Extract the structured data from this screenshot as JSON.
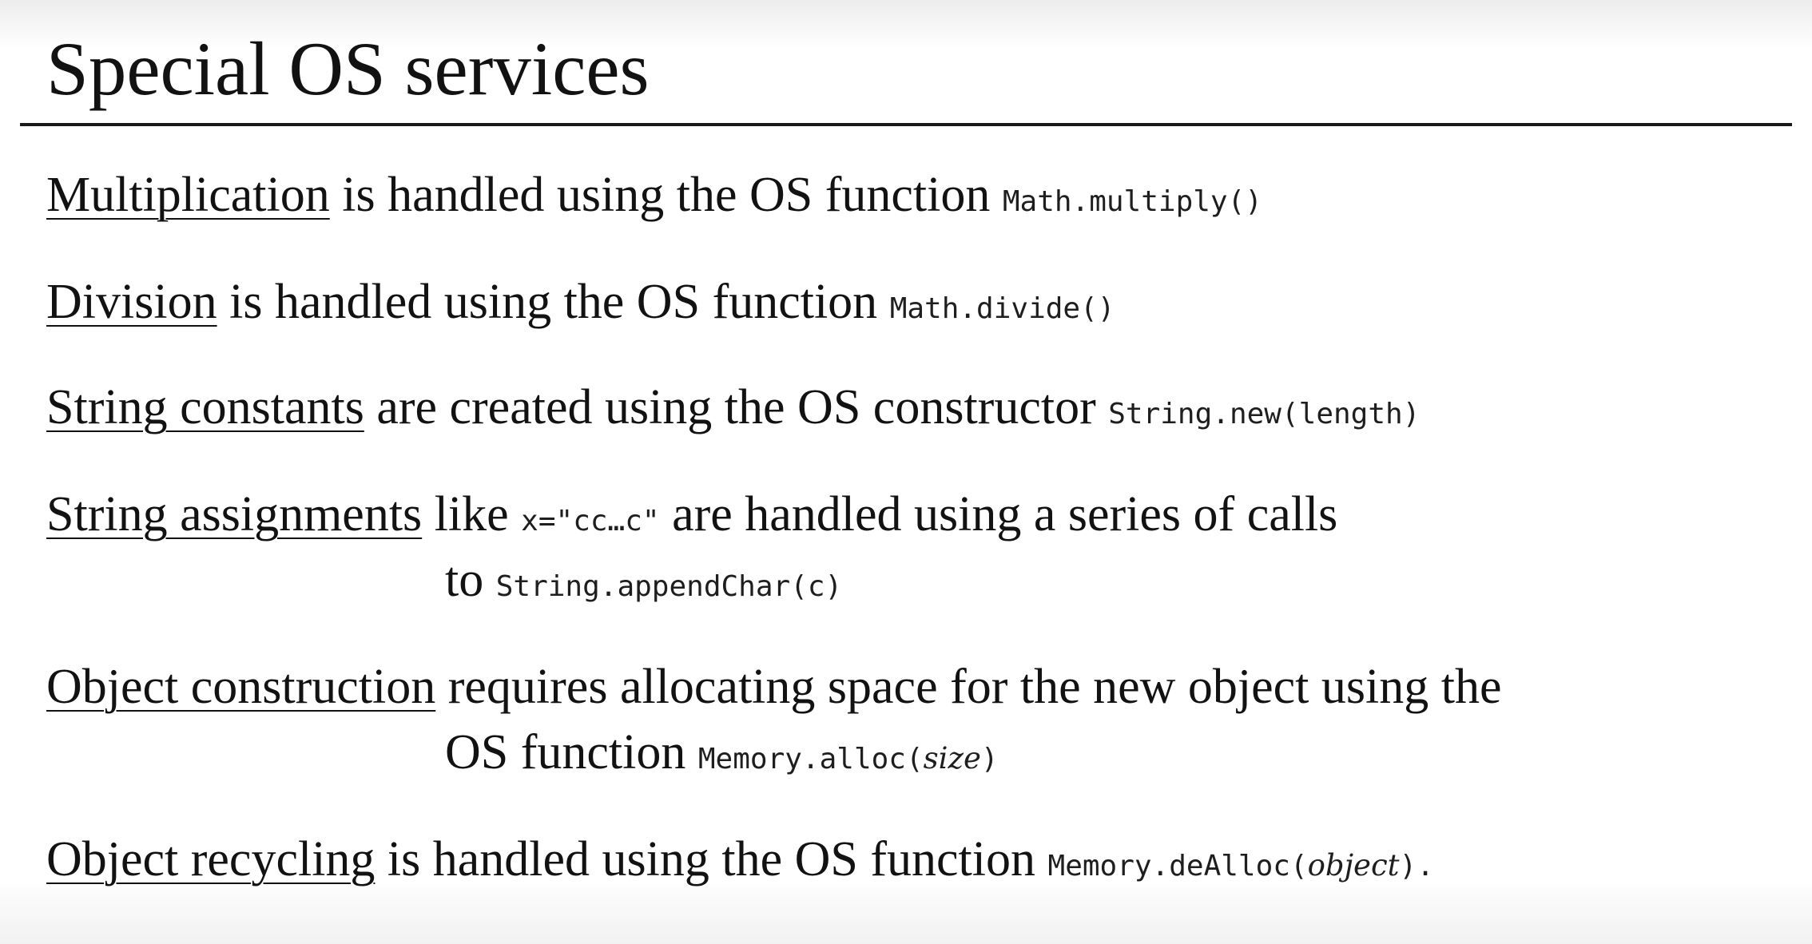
{
  "slide": {
    "title": "Special OS services",
    "items": [
      {
        "term": "Multiplication",
        "text": " is handled using the OS function ",
        "code": "Math.multiply()"
      },
      {
        "term": "Division",
        "text": " is handled using the OS function ",
        "code": "Math.divide()"
      },
      {
        "term": "String constants",
        "text": " are created using the OS constructor ",
        "code": "String.new(length)"
      },
      {
        "term": "String assignments",
        "text_before": " like ",
        "code_inline": "x=\"cc…c\"",
        "text_after": " are handled using a series of calls",
        "cont_text": "to ",
        "cont_code": "String.appendChar(c)"
      },
      {
        "term": "Object construction",
        "text": " requires allocating space for the new object using the",
        "cont_text": "OS function ",
        "cont_code": "Memory.alloc(",
        "cont_code_arg": "size",
        "cont_code_end": ")"
      },
      {
        "term": "Object recycling",
        "text": " is handled using the OS function ",
        "code": "Memory.deAlloc(",
        "code_arg": "object",
        "code_end": ").",
        "trail": ""
      }
    ]
  }
}
